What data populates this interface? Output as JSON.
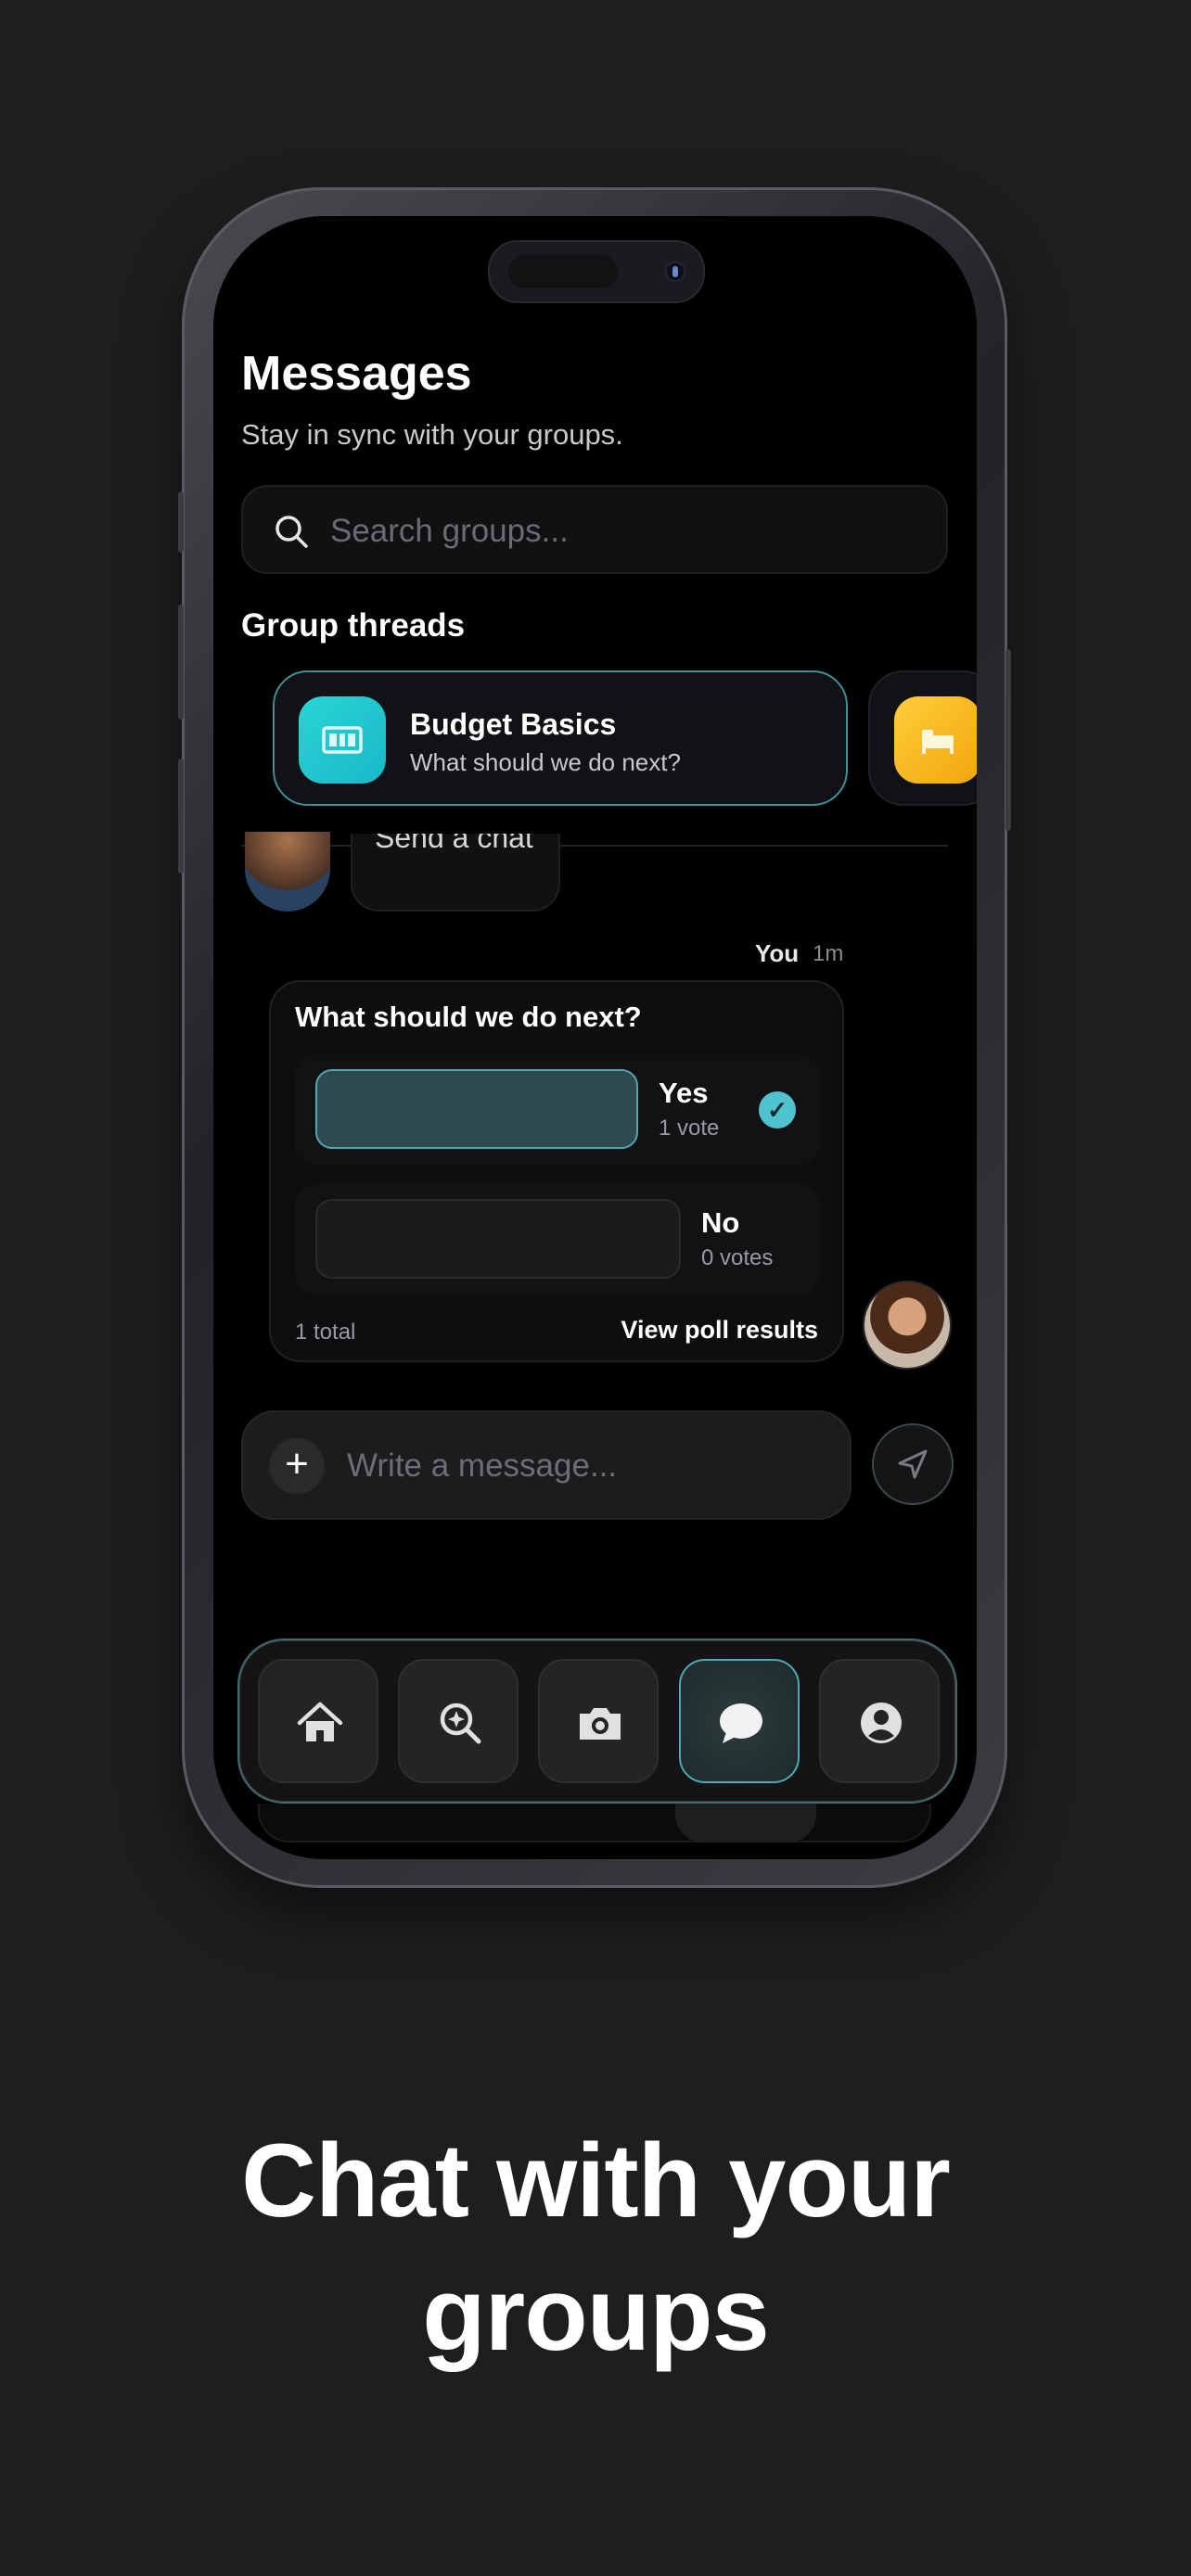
{
  "header": {
    "title": "Messages",
    "subtitle": "Stay in sync with your groups."
  },
  "search": {
    "placeholder": "Search groups..."
  },
  "section_title": "Group threads",
  "threads": [
    {
      "name": "Budget Basics",
      "preview": "What should we do next?",
      "color": "#22c8d3"
    },
    {
      "name": "",
      "preview": "",
      "color": "#f5b518"
    }
  ],
  "peek_message": {
    "text": "Send a chat"
  },
  "message_meta": {
    "sender": "You",
    "time": "1m"
  },
  "poll": {
    "question": "What should we do next?",
    "options": [
      {
        "label": "Yes",
        "votes": "1 vote",
        "share": 1.0,
        "selected": true
      },
      {
        "label": "No",
        "votes": "0 votes",
        "share": 0.0,
        "selected": false
      }
    ],
    "total": "1 total",
    "view_results": "View poll results"
  },
  "composer": {
    "placeholder": "Write a message..."
  },
  "nav": {
    "items": [
      {
        "icon": "home-icon",
        "active": false
      },
      {
        "icon": "discover-icon",
        "active": false
      },
      {
        "icon": "camera-icon",
        "active": false
      },
      {
        "icon": "chat-icon",
        "active": true
      },
      {
        "icon": "profile-icon",
        "active": false
      }
    ]
  },
  "headline": "Chat with your groups",
  "colors": {
    "accent": "#4fc3cf",
    "background": "#1e1e1f"
  }
}
